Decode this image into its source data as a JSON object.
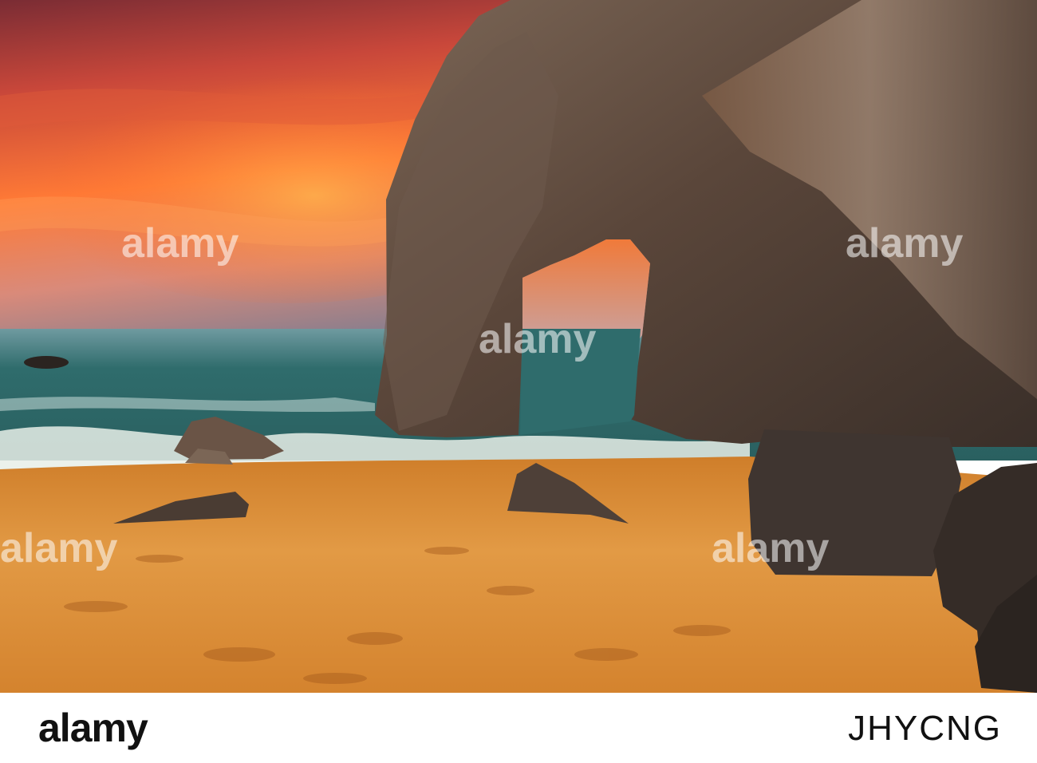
{
  "photo": {
    "colors": {
      "sky_top": "#6b2a2e",
      "sky_glow": "#ff6a2a",
      "sky_horizon": "#f4a16a",
      "sea": "#3c7b78",
      "sea_dark": "#1f4a4a",
      "foam": "#e8efe8",
      "sand": "#d98a35",
      "sand_dark": "#a55a1c",
      "rock": "#5a463a",
      "rock_light": "#8b7462",
      "rock_dark": "#2b2420"
    }
  },
  "watermark": {
    "text": "alamy"
  },
  "footer": {
    "logo": "alamy",
    "image_id": "JHYCNG"
  }
}
